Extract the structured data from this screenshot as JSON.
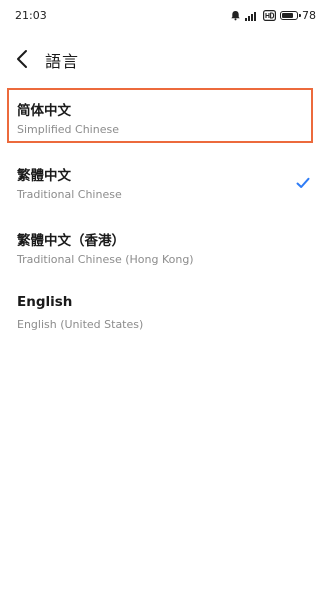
{
  "status_bar": {
    "time": "21:03",
    "battery_level": "78",
    "icons": [
      "alarm-icon",
      "signal-icon",
      "hd-icon",
      "battery-icon"
    ]
  },
  "header": {
    "title": "語言",
    "back_icon": "chevron-left-icon"
  },
  "languages": [
    {
      "name": "简体中文",
      "subtitle": "Simplified Chinese",
      "selected": false,
      "highlighted": true
    },
    {
      "name": "繁體中文",
      "subtitle": "Traditional Chinese",
      "selected": true,
      "highlighted": false
    },
    {
      "name": "繁體中文（香港）",
      "subtitle": "Traditional Chinese (Hong Kong)",
      "selected": false,
      "highlighted": false
    },
    {
      "name": "English",
      "subtitle": "English (United States)",
      "selected": false,
      "highlighted": false
    }
  ],
  "colors": {
    "accent": "#2e7cf6",
    "highlight_border": "#ec6a3c",
    "subtitle": "#8c8c8c"
  }
}
